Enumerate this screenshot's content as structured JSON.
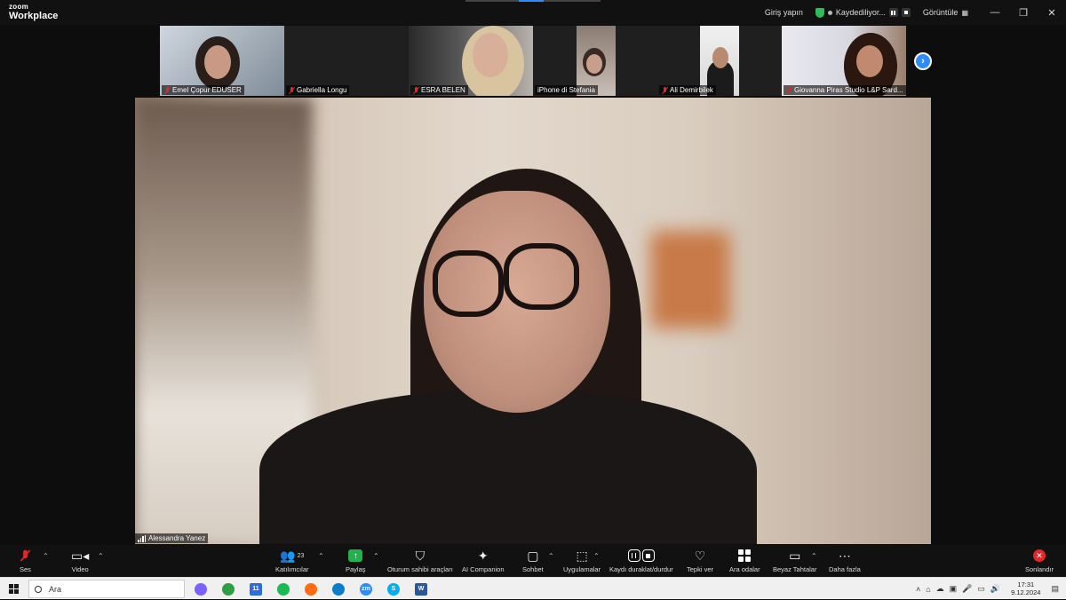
{
  "window": {
    "brand_small": "zoom",
    "brand_large": "Workplace",
    "signin": "Giriş yapın",
    "recording": "Kaydediliyor...",
    "view": "Görüntüle",
    "minimize": "—",
    "restore": "❐",
    "close": "✕"
  },
  "thumbnails": [
    {
      "name": "Emel Çopur EDUSER",
      "muted": true
    },
    {
      "name": "Gabriella Longu",
      "muted": true
    },
    {
      "name": "ESRA BELEN",
      "muted": true
    },
    {
      "name": "iPhone di Stefania",
      "muted": false
    },
    {
      "name": "Ali Demirbilek",
      "muted": true
    },
    {
      "name": "Giovanna Piras Studio L&P Sard...",
      "muted": true
    }
  ],
  "next_page": "›",
  "main_speaker": {
    "name": "Alessandra Yanez"
  },
  "toolbar": {
    "audio": "Ses",
    "video": "Video",
    "participants": "Katılımcılar",
    "participants_count": "23",
    "share": "Paylaş",
    "host_tools": "Oturum sahibi araçları",
    "ai_companion": "AI Companion",
    "chat": "Sohbet",
    "apps": "Uygulamalar",
    "record": "Kaydı duraklat/durdur",
    "reactions": "Tepki ver",
    "breakout": "Ara odalar",
    "whiteboards": "Beyaz Tahtalar",
    "more": "Daha fazla",
    "end": "Sonlandır"
  },
  "taskbar": {
    "search_placeholder": "Ara",
    "time": "17:31",
    "date": "9.12.2024",
    "apps": [
      {
        "name": "copilot",
        "color": "#7b61ff",
        "glyph": ""
      },
      {
        "name": "chrome",
        "color": "#2f9e44",
        "glyph": ""
      },
      {
        "name": "mail",
        "color": "#2d6cdf",
        "glyph": "11"
      },
      {
        "name": "spotify",
        "color": "#1db954",
        "glyph": ""
      },
      {
        "name": "firefox",
        "color": "#ff6a13",
        "glyph": ""
      },
      {
        "name": "edge",
        "color": "#0f7cc9",
        "glyph": ""
      },
      {
        "name": "zoom",
        "color": "#2d8cff",
        "glyph": "zm"
      },
      {
        "name": "skype",
        "color": "#00aff0",
        "glyph": "S"
      },
      {
        "name": "word",
        "color": "#2b579a",
        "glyph": "W"
      }
    ]
  }
}
